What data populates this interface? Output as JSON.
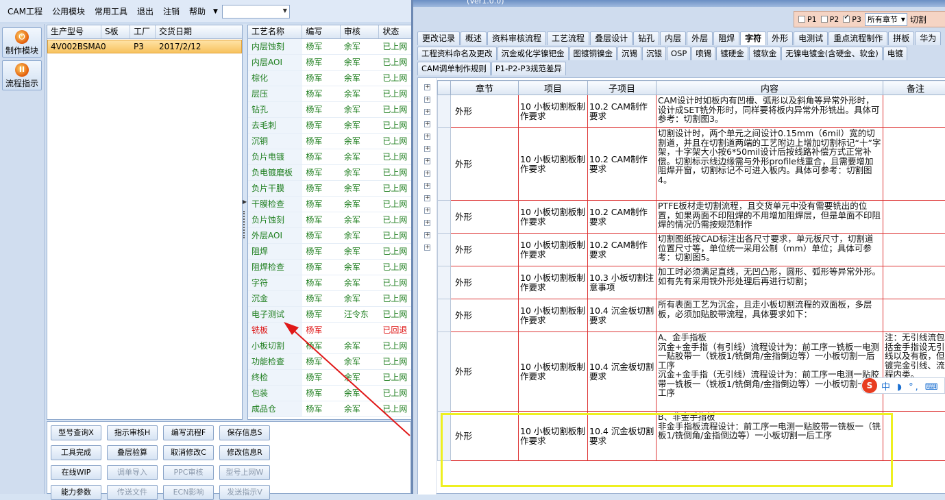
{
  "menubar": {
    "items": [
      "CAM工程",
      "公用模块",
      "常用工具",
      "退出",
      "注销",
      "帮助"
    ],
    "combo_value": ""
  },
  "leftbar": {
    "buttons": [
      {
        "label": "制作模块",
        "icon": "power-icon"
      },
      {
        "label": "流程指示",
        "icon": "pause-icon"
      }
    ]
  },
  "orders": {
    "columns": [
      "生产型号",
      "S板",
      "工厂",
      "交货日期"
    ],
    "rows": [
      {
        "model": "4V002BSMA0",
        "s": "",
        "factory": "P3",
        "date": "2017/2/12"
      }
    ]
  },
  "process": {
    "columns": [
      "工艺名称",
      "编写",
      "审核",
      "状态"
    ],
    "rows": [
      {
        "name": "内层蚀刻",
        "writer": "杨军",
        "reviewer": "余军",
        "status": "已上网",
        "alert": false
      },
      {
        "name": "内层AOI",
        "writer": "杨军",
        "reviewer": "余军",
        "status": "已上网",
        "alert": false
      },
      {
        "name": "棕化",
        "writer": "杨军",
        "reviewer": "余军",
        "status": "已上网",
        "alert": false
      },
      {
        "name": "层压",
        "writer": "杨军",
        "reviewer": "余军",
        "status": "已上网",
        "alert": false
      },
      {
        "name": "钻孔",
        "writer": "杨军",
        "reviewer": "余军",
        "status": "已上网",
        "alert": false
      },
      {
        "name": "去毛刺",
        "writer": "杨军",
        "reviewer": "余军",
        "status": "已上网",
        "alert": false
      },
      {
        "name": "沉铜",
        "writer": "杨军",
        "reviewer": "余军",
        "status": "已上网",
        "alert": false
      },
      {
        "name": "负片电镀",
        "writer": "杨军",
        "reviewer": "余军",
        "status": "已上网",
        "alert": false
      },
      {
        "name": "负电镀磨板",
        "writer": "杨军",
        "reviewer": "余军",
        "status": "已上网",
        "alert": false
      },
      {
        "name": "负片干膜",
        "writer": "杨军",
        "reviewer": "余军",
        "status": "已上网",
        "alert": false
      },
      {
        "name": "干膜检查",
        "writer": "杨军",
        "reviewer": "余军",
        "status": "已上网",
        "alert": false
      },
      {
        "name": "负片蚀刻",
        "writer": "杨军",
        "reviewer": "余军",
        "status": "已上网",
        "alert": false
      },
      {
        "name": "外层AOI",
        "writer": "杨军",
        "reviewer": "余军",
        "status": "已上网",
        "alert": false
      },
      {
        "name": "阻焊",
        "writer": "杨军",
        "reviewer": "余军",
        "status": "已上网",
        "alert": false
      },
      {
        "name": "阻焊检查",
        "writer": "杨军",
        "reviewer": "余军",
        "status": "已上网",
        "alert": false
      },
      {
        "name": "字符",
        "writer": "杨军",
        "reviewer": "余军",
        "status": "已上网",
        "alert": false
      },
      {
        "name": "沉金",
        "writer": "杨军",
        "reviewer": "余军",
        "status": "已上网",
        "alert": false
      },
      {
        "name": "电子测试",
        "writer": "杨军",
        "reviewer": "汪令东",
        "status": "已上网",
        "alert": false
      },
      {
        "name": "铣板",
        "writer": "杨军",
        "reviewer": "",
        "status": "已回退",
        "alert": true
      },
      {
        "name": "小板切割",
        "writer": "杨军",
        "reviewer": "余军",
        "status": "已上网",
        "alert": false
      },
      {
        "name": "功能检查",
        "writer": "杨军",
        "reviewer": "余军",
        "status": "已上网",
        "alert": false
      },
      {
        "name": "终检",
        "writer": "杨军",
        "reviewer": "余军",
        "status": "已上网",
        "alert": false
      },
      {
        "name": "包装",
        "writer": "杨军",
        "reviewer": "余军",
        "status": "已上网",
        "alert": false
      },
      {
        "name": "成品仓",
        "writer": "杨军",
        "reviewer": "余军",
        "status": "已上网",
        "alert": false
      }
    ]
  },
  "actions": [
    {
      "label": "型号查询X",
      "enabled": true
    },
    {
      "label": "指示审核H",
      "enabled": true
    },
    {
      "label": "编写流程F",
      "enabled": true
    },
    {
      "label": "保存信息S",
      "enabled": true
    },
    {
      "label": "工具完成",
      "enabled": true
    },
    {
      "label": "叠层验算",
      "enabled": true
    },
    {
      "label": "取消修改C",
      "enabled": true
    },
    {
      "label": "修改信息R",
      "enabled": true
    },
    {
      "label": "在线WIP",
      "enabled": true
    },
    {
      "label": "调单导入",
      "enabled": false
    },
    {
      "label": "PPC审核",
      "enabled": false
    },
    {
      "label": "型号上网W",
      "enabled": false
    },
    {
      "label": "能力参数",
      "enabled": true
    },
    {
      "label": "传送文件",
      "enabled": false
    },
    {
      "label": "ECN影响",
      "enabled": false
    },
    {
      "label": "发送指示V",
      "enabled": false
    }
  ],
  "window": {
    "title": "(Ver1.0.0)",
    "filters": [
      {
        "label": "P1",
        "checked": false
      },
      {
        "label": "P2",
        "checked": false
      },
      {
        "label": "P3",
        "checked": true
      }
    ],
    "chapter_select": "所有章节",
    "cut_label": "切割",
    "tabs_row1": [
      "更改记录",
      "概述",
      "资料审核流程",
      "工艺流程",
      "叠层设计",
      "钻孔",
      "内层",
      "外层",
      "阻焊",
      "字符",
      "外形",
      "电测试",
      "重点流程制作",
      "拼板",
      "华为"
    ],
    "tabs_row1_active": 9,
    "tabs_row2": [
      "工程资料命名及更改",
      "沉金或化学镍钯金",
      "图镀铜镍金",
      "沉锡",
      "沉银",
      "OSP",
      "喷锡",
      "镀硬金",
      "镀软金",
      "无镍电镀金(含硬金、软金)",
      "电镀"
    ],
    "tabs_row3": [
      "CAM调单制作规则",
      "P1-P2-P3规范差异"
    ],
    "columns": [
      "章节",
      "项目",
      "子项目",
      "内容",
      "备注"
    ],
    "rows": [
      {
        "chapter": "外形",
        "item": "10 小板切割板制作要求",
        "sub": "10.2 CAM制作要求",
        "content": "CAM设计时如板内有凹槽、弧形以及斜角等异常外形时，设计成SET铣外形时，同样要将板内异常外形铣出。具体可参考：切割图3。",
        "note": ""
      },
      {
        "chapter": "外形",
        "item": "10 小板切割板制作要求",
        "sub": "10.2 CAM制作要求",
        "content": "切割设计时，两个单元之间设计0.15mm（6mil）宽的切割道，并且在切割道两端的工艺附边上增加切割标记“十”字架，十字架大小按6*50mil设计后按线路补偿方式正常补偿。切割标示线边缘需与外形profile线重合，且需要增加阻焊开窗，切割标记不可进入板内。具体可参考：切割图4。",
        "note": ""
      },
      {
        "chapter": "外形",
        "item": "10 小板切割板制作要求",
        "sub": "10.2 CAM制作要求",
        "content": "PTFE板材走切割流程，且交货单元中没有需要铣出的位置，如果两面不印阻焊的不用增加阻焊层，但是单面不印阻焊的情况仍需按规范制作",
        "note": ""
      },
      {
        "chapter": "外形",
        "item": "10 小板切割板制作要求",
        "sub": "10.2 CAM制作要求",
        "content": "切割图纸按CAD标注出各尺寸要求，单元板尺寸，切割道位置尺寸等，单位统一采用公制（mm）单位；具体可参考：切割图5。",
        "note": ""
      },
      {
        "chapter": "外形",
        "item": "10 小板切割板制作要求",
        "sub": "10.3 小板切割注意事项",
        "content": "加工时必须满足直线，无凹凸形，圆形、弧形等异常外形。如有先有采用铣外形处理后再进行切割；",
        "note": ""
      },
      {
        "chapter": "外形",
        "item": "10 小板切割板制作要求",
        "sub": "10.4 沉金板切割要求",
        "content": "所有表面工艺为沉金，且走小板切割流程的双面板，多层板，必须加贴胶带流程，具体要求如下：",
        "note": ""
      },
      {
        "chapter": "外形",
        "item": "10 小板切割板制作要求",
        "sub": "10.4 沉金板切割要求",
        "content": "A、金手指板\n沉金+金手指（有引线）流程设计为：前工序一铣板一电测一贴胶带一（铣板1/铣倒角/金指倒边等）一小板切割一后工序\n沉金+金手指（无引线）流程设计为：前工序一电测一贴胶带一铣板一（铣板1/铣倒角/金指倒边等）一小板切割一后工序",
        "note": "注：无引线流包括金手指设无引线以及有板，但镀完金引线、流程内类。"
      },
      {
        "chapter": "外形",
        "item": "10 小板切割板制作要求",
        "sub": "10.4 沉金板切割要求",
        "content": "B、非金手指板\n非金手指板流程设计：前工序一电测一贴胶带一铣板一（铣板1/铣倒角/金指倒边等）一小板切割一后工序",
        "note": ""
      }
    ]
  },
  "ime": {
    "logo": "S",
    "text": "中 ◗ °, ⌨"
  }
}
